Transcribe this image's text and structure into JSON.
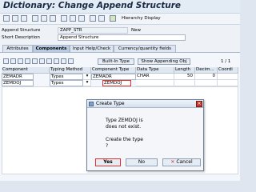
{
  "window": {
    "title": "Dictionary: Change Append Structure"
  },
  "toolbar": {
    "hierarchy_label": "Hierarchy Display"
  },
  "header": {
    "append_label": "Append Structure",
    "append_value": "ZAPP_STR",
    "status_value": "New",
    "short_desc_label": "Short Description",
    "short_desc_value": "Append Structure"
  },
  "tabs": [
    "Attributes",
    "Components",
    "Input Help/Check",
    "Currency/quantity fields"
  ],
  "active_tab": "Components",
  "grid_toolbar": {
    "builtin_label": "Built-In Type",
    "show_append_label": "Show Appending Obj",
    "page_info": "1 / 1"
  },
  "table": {
    "headers": [
      "Component",
      "Typing Method",
      "Component Type",
      "Data Type",
      "Length",
      "Decim...",
      "Coordi"
    ],
    "rows": [
      [
        "ZEMADR",
        "Types",
        "ZEMADR",
        "CHAR",
        "50",
        "0",
        ""
      ],
      [
        "ZEMDOJ",
        "Types",
        "ZEMDOJ",
        "",
        "",
        "",
        ""
      ]
    ]
  },
  "dialog": {
    "title": "Create Type",
    "message_line1": "Type ZEMDOJ is",
    "message_line2": "does not exist.",
    "question": "Create the type",
    "question_mark": "?",
    "yes_label": "Yes",
    "no_label": "No",
    "cancel_label": "Cancel"
  },
  "colors": {
    "highlight": "#e03030",
    "title_text": "#1b2a44",
    "active_tab": "#b8cbe2"
  }
}
